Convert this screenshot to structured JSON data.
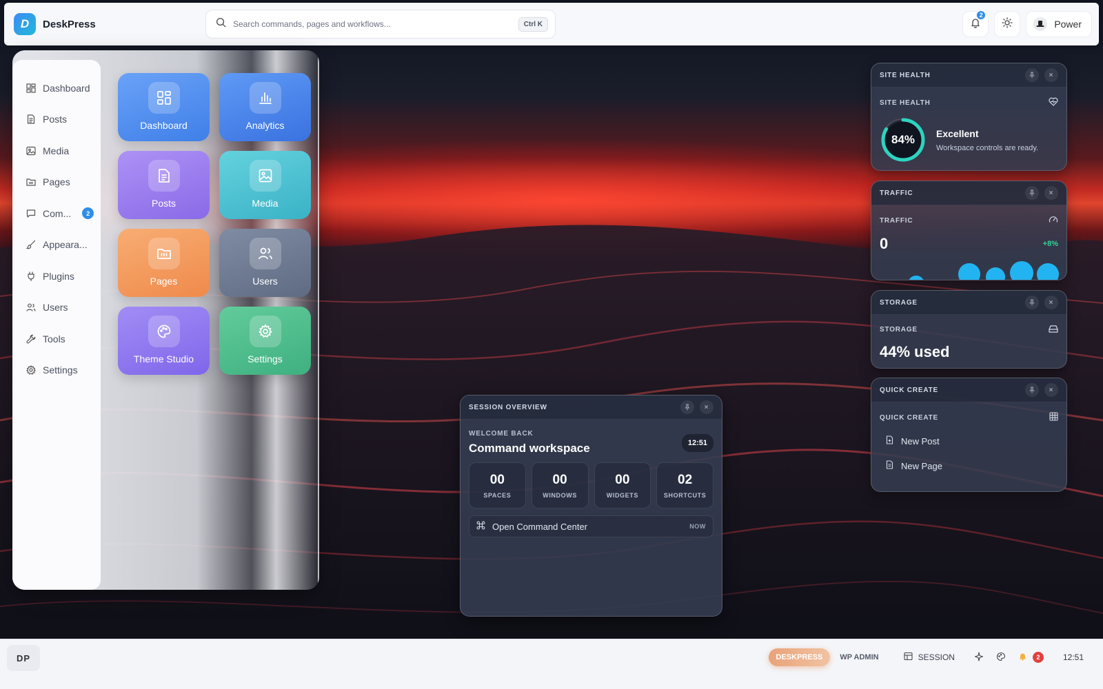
{
  "app": {
    "logo_letter": "D",
    "name": "DeskPress"
  },
  "search": {
    "placeholder": "Search commands, pages and workflows...",
    "shortcut": "Ctrl K"
  },
  "topbar": {
    "notifications_count": "2",
    "power_label": "Power"
  },
  "sidebar": {
    "items": [
      {
        "label": "Dashboard",
        "icon": "dashboard-icon"
      },
      {
        "label": "Posts",
        "icon": "posts-icon"
      },
      {
        "label": "Media",
        "icon": "media-icon"
      },
      {
        "label": "Pages",
        "icon": "pages-icon"
      },
      {
        "label": "Com...",
        "icon": "comments-icon",
        "badge": "2"
      },
      {
        "label": "Appeara...",
        "icon": "brush-icon"
      },
      {
        "label": "Plugins",
        "icon": "plug-icon"
      },
      {
        "label": "Users",
        "icon": "users-icon"
      },
      {
        "label": "Tools",
        "icon": "wrench-icon"
      },
      {
        "label": "Settings",
        "icon": "gear-icon"
      }
    ]
  },
  "tiles": [
    {
      "label": "Dashboard",
      "icon": "grid-icon",
      "color": "#4f8ef2"
    },
    {
      "label": "Analytics",
      "icon": "bar-chart-icon",
      "color": "#4a86ee"
    },
    {
      "label": "Posts",
      "icon": "document-icon",
      "color": "#9b7ff0"
    },
    {
      "label": "Media",
      "icon": "image-icon",
      "color": "#4cc4d4"
    },
    {
      "label": "Pages",
      "icon": "folder-icon",
      "color": "#f59b5e"
    },
    {
      "label": "Users",
      "icon": "users-icon",
      "color": "#6f7c92"
    },
    {
      "label": "Theme Studio",
      "icon": "palette-icon",
      "color": "#9179ee"
    },
    {
      "label": "Settings",
      "icon": "gear-icon",
      "color": "#4fbf8f"
    }
  ],
  "widgets": {
    "site_health": {
      "header": "SITE HEALTH",
      "subheader": "SITE HEALTH",
      "percent": 84,
      "percent_label": "84%",
      "status": "Excellent",
      "message": "Workspace controls are ready.",
      "ring_color": "#2dd4bf"
    },
    "traffic": {
      "header": "TRAFFIC",
      "subheader": "TRAFFIC",
      "value": "0",
      "change": "+8%"
    },
    "storage": {
      "header": "STORAGE",
      "subheader": "STORAGE",
      "value": "44% used"
    },
    "quick_create": {
      "header": "QUICK CREATE",
      "subheader": "QUICK CREATE",
      "items": [
        {
          "label": "New Post",
          "icon": "new-post-icon"
        },
        {
          "label": "New Page",
          "icon": "new-page-icon"
        }
      ]
    }
  },
  "session": {
    "header": "SESSION OVERVIEW",
    "eyebrow": "WELCOME BACK",
    "title": "Command workspace",
    "time": "12:51",
    "stats": [
      {
        "value": "00",
        "label": "SPACES"
      },
      {
        "value": "00",
        "label": "WINDOWS"
      },
      {
        "value": "00",
        "label": "WIDGETS"
      },
      {
        "value": "02",
        "label": "SHORTCUTS"
      }
    ],
    "command": {
      "label": "Open Command Center",
      "meta": "NOW"
    }
  },
  "taskbar": {
    "start_label": "DP",
    "brand_pill": "DESKPRESS",
    "wp_admin": "WP ADMIN",
    "session_label": "SESSION",
    "alerts_count": "2",
    "time": "12:51"
  }
}
